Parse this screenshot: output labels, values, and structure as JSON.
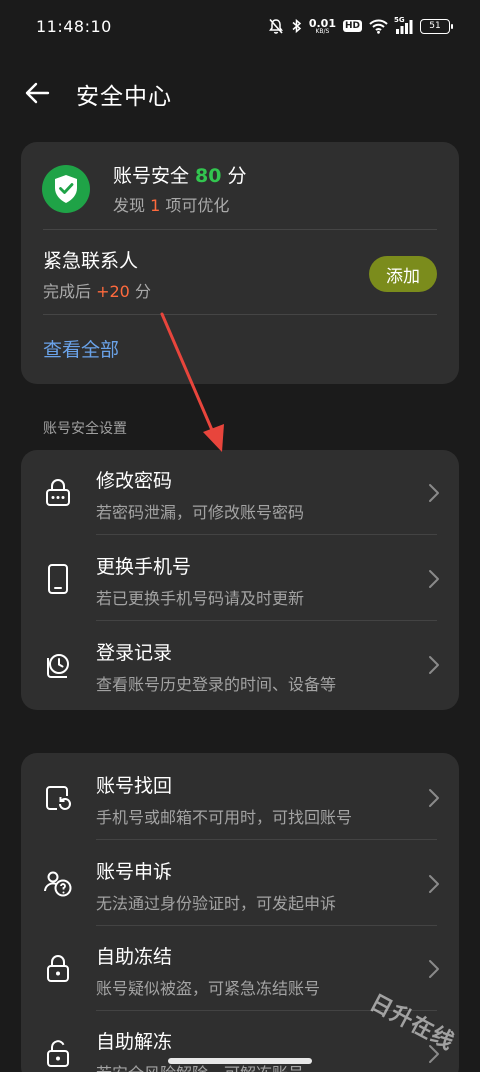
{
  "status_bar": {
    "time": "11:48:10",
    "net_speed_value": "0.01",
    "net_speed_unit": "KB/S",
    "hd_label": "HD",
    "signal_label": "5G",
    "battery_level": "51",
    "icons": [
      "bell-muted-icon",
      "bluetooth-icon",
      "wifi-icon",
      "signal-icon",
      "battery-icon"
    ]
  },
  "header": {
    "back_icon": "arrow-left-icon",
    "title": "安全中心"
  },
  "summary": {
    "score_prefix": "账号安全 ",
    "score_value": "80",
    "score_suffix": " 分",
    "sub_prefix": "发现 ",
    "sub_count": "1",
    "sub_suffix": " 项可优化",
    "contact_title": "紧急联系人",
    "contact_sub_prefix": "完成后 ",
    "contact_bonus": "+20",
    "contact_sub_suffix": " 分",
    "add_label": "添加",
    "view_all": "查看全部"
  },
  "section_label": "账号安全设置",
  "settings_items": [
    {
      "title": "修改密码",
      "subtitle": "若密码泄漏，可修改账号密码",
      "icon": "lock-dots-icon"
    },
    {
      "title": "更换手机号",
      "subtitle": "若已更换手机号码请及时更新",
      "icon": "phone-icon"
    },
    {
      "title": "登录记录",
      "subtitle": "查看账号历史登录的时间、设备等",
      "icon": "clock-history-icon"
    }
  ],
  "recovery_items": [
    {
      "title": "账号找回",
      "subtitle": "手机号或邮箱不可用时，可找回账号",
      "icon": "account-recover-icon"
    },
    {
      "title": "账号申诉",
      "subtitle": "无法通过身份验证时，可发起申诉",
      "icon": "appeal-icon"
    },
    {
      "title": "自助冻结",
      "subtitle": "账号疑似被盗，可紧急冻结账号",
      "icon": "lock-icon"
    },
    {
      "title": "自助解冻",
      "subtitle": "若安全风险解除，可解冻账号",
      "icon": "unlock-icon"
    }
  ],
  "watermark": "日升在线",
  "colors": {
    "background": "#1b1b1b",
    "card": "#2f2f2f",
    "accent_green": "#32c54f",
    "accent_orange": "#ff6a3d",
    "link_blue": "#6aa2e8",
    "add_button": "#7b8c1c",
    "annotation_red": "#e8453c"
  }
}
